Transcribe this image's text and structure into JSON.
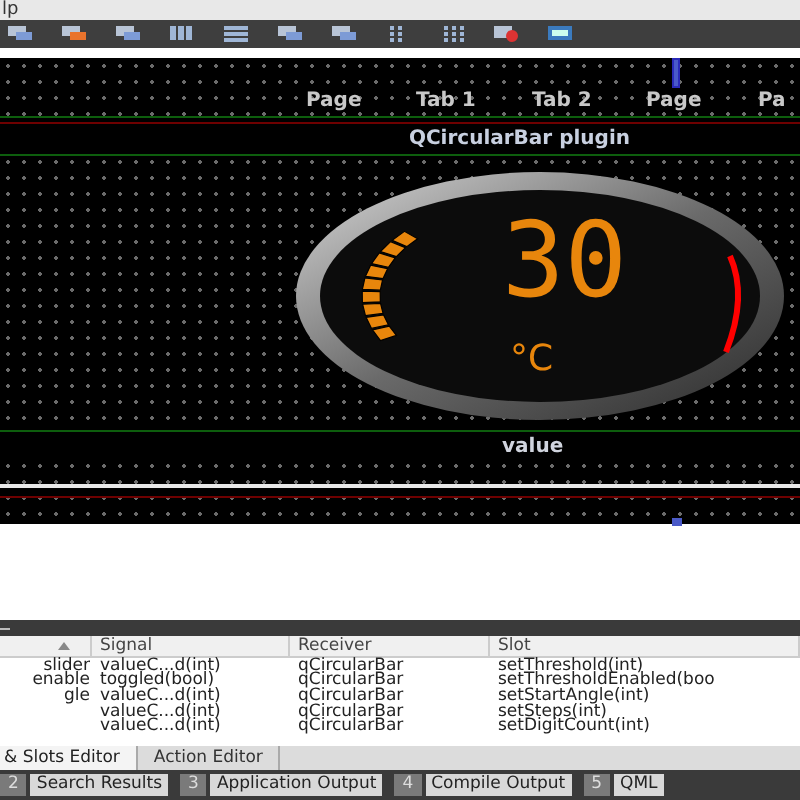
{
  "menu_bar": {
    "text": "lp"
  },
  "canvas": {
    "tabs": [
      "Page",
      "Tab 1",
      "Tab 2",
      "Page",
      "Pa"
    ],
    "title": "QCircularBar plugin",
    "gauge": {
      "value": "30",
      "unit": "°C"
    },
    "label": "value"
  },
  "table": {
    "columns": [
      {
        "sorted": true
      },
      {
        "label": "Signal",
        "sorted": false
      },
      {
        "label": "Receiver",
        "sorted": false
      },
      {
        "label": "Slot",
        "sorted": false
      }
    ],
    "rows": [
      {
        "column_1": "slider",
        "signal": "valueC...d(int)",
        "receiver": "qCircularBar",
        "slot": "setThreshold(int)"
      },
      {
        "column_1": "enable",
        "signal": "toggled(bool)",
        "receiver": "qCircularBar",
        "slot": "setThresholdEnabled(boo"
      },
      {
        "column_1": "gle",
        "signal": "valueC...d(int)",
        "receiver": "qCircularBar",
        "slot": "setStartAngle(int)"
      },
      {
        "signal": "valueC...d(int)",
        "receiver": "qCircularBar",
        "slot": "setSteps(int)"
      },
      {
        "signal": "valueC...d(int)",
        "receiver": "qCircularBar",
        "slot": "setDigitCount(int)"
      }
    ]
  },
  "editor_tabs": [
    {
      "label": "& Slots Editor",
      "selected": true
    },
    {
      "label": "Action Editor",
      "selected": false
    }
  ],
  "output_buttons": [
    {
      "number": "2",
      "label": "Search Results"
    },
    {
      "number": "3",
      "label": "Application Output"
    },
    {
      "number": "4",
      "label": "Compile Output"
    },
    {
      "number": "5",
      "label": "QML"
    }
  ]
}
